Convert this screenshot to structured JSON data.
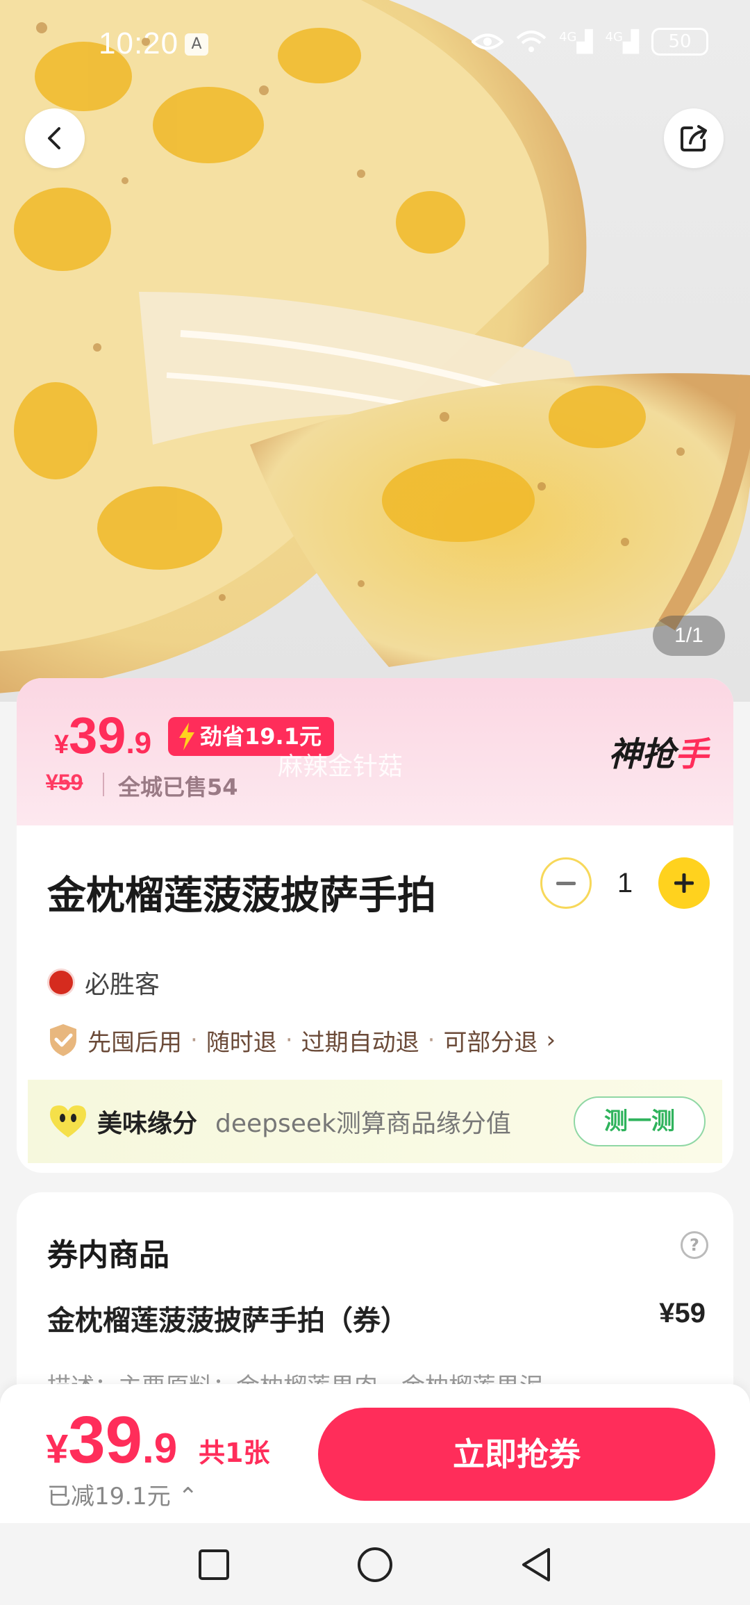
{
  "status_bar": {
    "time": "10:20",
    "badge": "A",
    "network_1": "4G",
    "network_2": "4G",
    "battery": "50"
  },
  "hero": {
    "image_counter": "1/1"
  },
  "price_band": {
    "currency": "¥",
    "price_int": "39",
    "price_dec": ".9",
    "save_label": "劲省19.1元",
    "original_price": "¥59",
    "sold_text": "全城已售54",
    "watermark": "麻辣金针菇",
    "brand_logo_main": "神抢",
    "brand_logo_end": "手"
  },
  "product": {
    "title": "金枕榴莲菠菠披萨手拍",
    "quantity": "1"
  },
  "store": {
    "name": "必胜客"
  },
  "policies": {
    "items": [
      "先囤后用",
      "随时退",
      "过期自动退",
      "可部分退"
    ],
    "chevron": "›"
  },
  "fate": {
    "title": "美味缘分",
    "description": "deepseek测算商品缘分值",
    "button": "测一测"
  },
  "coupon_items": {
    "title": "券内商品",
    "help": "?",
    "item_name": "金枕榴莲菠菠披萨手拍（券）",
    "item_price": "¥59",
    "description": "描述：主要原料：金枕榴莲果肉、金枕榴莲果泥"
  },
  "bottom_bar": {
    "currency": "¥",
    "price_int": "39",
    "price_dec": ".9",
    "count": "共1张",
    "reduced": "已减19.1元",
    "reduced_chevron": "⌃",
    "buy_button": "立即抢券"
  },
  "colors": {
    "accent": "#ff2d5a",
    "yellow": "#ffd21e",
    "green": "#2fb35c"
  }
}
